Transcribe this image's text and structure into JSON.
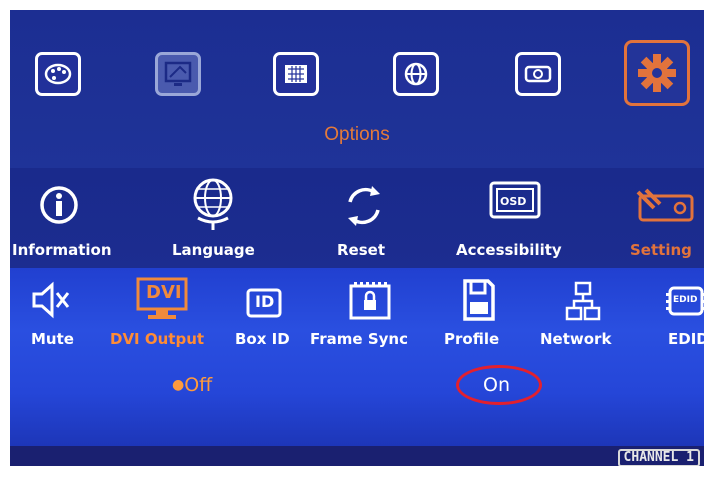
{
  "top_menu": {
    "title": "Options",
    "icons": [
      "palette-icon",
      "pip-icon",
      "input-icon",
      "globe-icon",
      "projector-icon",
      "gear-icon"
    ],
    "selected": "gear-icon"
  },
  "options_menu": {
    "items": [
      {
        "label": "Information",
        "icon": "info-icon"
      },
      {
        "label": "Language",
        "icon": "globe-icon"
      },
      {
        "label": "Reset",
        "icon": "reset-icon"
      },
      {
        "label": "Accessibility",
        "icon": "osd-icon"
      },
      {
        "label": "Setting",
        "icon": "setting-tools-icon"
      }
    ],
    "selected": "Setting"
  },
  "setting_menu": {
    "items": [
      {
        "label": "Mute",
        "icon": "mute-icon"
      },
      {
        "label": "DVI Output",
        "icon": "dvi-icon"
      },
      {
        "label": "Box ID",
        "icon": "id-icon"
      },
      {
        "label": "Frame Sync",
        "icon": "frame-sync-icon"
      },
      {
        "label": "Profile",
        "icon": "save-icon"
      },
      {
        "label": "Network",
        "icon": "network-icon"
      },
      {
        "label": "EDID",
        "icon": "edid-icon"
      }
    ],
    "selected": "DVI Output",
    "icon_texts": {
      "dvi": "DVI",
      "id": "ID",
      "osd": "OSD",
      "edid": "EDID"
    }
  },
  "dvi_output_options": {
    "off": "Off",
    "on": "On",
    "current": "Off",
    "highlighted": "On"
  },
  "status": {
    "channel": "CHANNEL 1"
  },
  "colors": {
    "accent": "#e47a3a",
    "background": "#1e2f94",
    "highlight": "#e3202e"
  }
}
